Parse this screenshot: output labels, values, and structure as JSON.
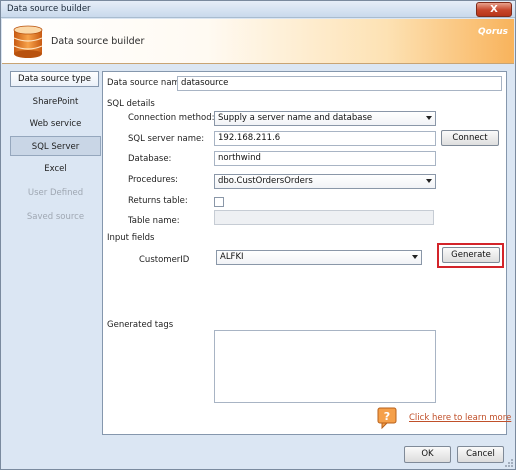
{
  "window": {
    "title": "Data source builder",
    "close_label": "X"
  },
  "header": {
    "title": "Data source builder",
    "brand": "Qorus"
  },
  "nav": {
    "heading": "Data source type",
    "items": [
      {
        "label": "SharePoint",
        "state": "normal"
      },
      {
        "label": "Web service",
        "state": "normal"
      },
      {
        "label": "SQL Server",
        "state": "selected"
      },
      {
        "label": "Excel",
        "state": "normal"
      },
      {
        "label": "User Defined",
        "state": "disabled"
      },
      {
        "label": "Saved source",
        "state": "disabled"
      }
    ]
  },
  "form": {
    "name_label": "Data source name",
    "name_value": "datasource",
    "sql_section": "SQL details",
    "connection_label": "Connection method:",
    "connection_value": "Supply a server name and database",
    "server_label": "SQL server name:",
    "server_value": "192.168.211.6",
    "connect_label": "Connect",
    "database_label": "Database:",
    "database_value": "northwind",
    "procedures_label": "Procedures:",
    "procedures_value": "dbo.CustOrdersOrders",
    "returns_table_label": "Returns table:",
    "returns_table_checked": false,
    "table_name_label": "Table name:",
    "table_name_value": "",
    "input_fields_section": "Input fields",
    "param_label": "CustomerID",
    "param_value": "ALFKI",
    "generate_label": "Generate",
    "generated_tags_label": "Generated tags",
    "generated_tags_value": "",
    "help_link": "Click here to learn more"
  },
  "footer": {
    "ok_label": "OK",
    "cancel_label": "Cancel"
  },
  "colors": {
    "header_accent": "#f8b35c",
    "highlight": "#d3242a",
    "link": "#c0502a",
    "selected_nav": "#c9d6e6"
  }
}
